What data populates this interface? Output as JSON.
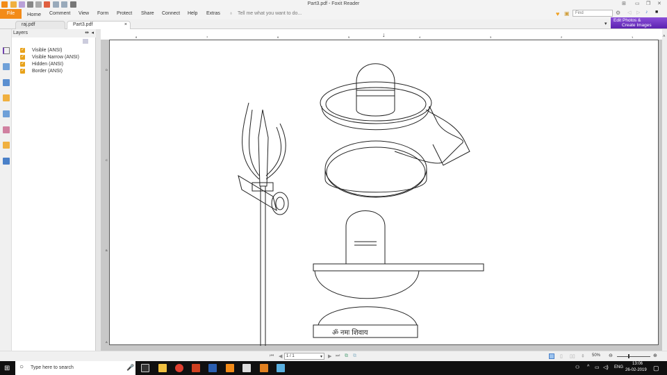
{
  "window": {
    "title": "Part3.pdf - Foxit Reader"
  },
  "menu": {
    "file": "File",
    "items": [
      "Home",
      "Comment",
      "View",
      "Form",
      "Protect",
      "Share",
      "Connect",
      "Help",
      "Extras"
    ],
    "tell_me": "Tell me what you want to do..."
  },
  "search": {
    "placeholder": "Find"
  },
  "promo": {
    "line1": "Edit Photos &",
    "line2": "Create Images"
  },
  "tabs": [
    {
      "label": "raj.pdf"
    },
    {
      "label": "Part3.pdf",
      "close": "×"
    }
  ],
  "layers": {
    "title": "Layers",
    "items": [
      "Visible (ANSI)",
      "Visible Narrow (ANSI)",
      "Hidden (ANSI)",
      "Border (ANSI)"
    ]
  },
  "ruler": {
    "top": [
      "8",
      "7",
      "6",
      "5",
      "4",
      "3",
      "2",
      "1"
    ],
    "left": [
      "D",
      "C",
      "B",
      "A"
    ]
  },
  "statusbar": {
    "page": "1 / 1",
    "zoom": "50%"
  },
  "taskbar": {
    "search": "Type here to search",
    "lang": "ENG",
    "time": "13:06",
    "date": "26-02-2019"
  },
  "colors": {
    "accent": "#f38b18",
    "checkbox": "#e8a21a",
    "promo": "#6a32c4"
  }
}
